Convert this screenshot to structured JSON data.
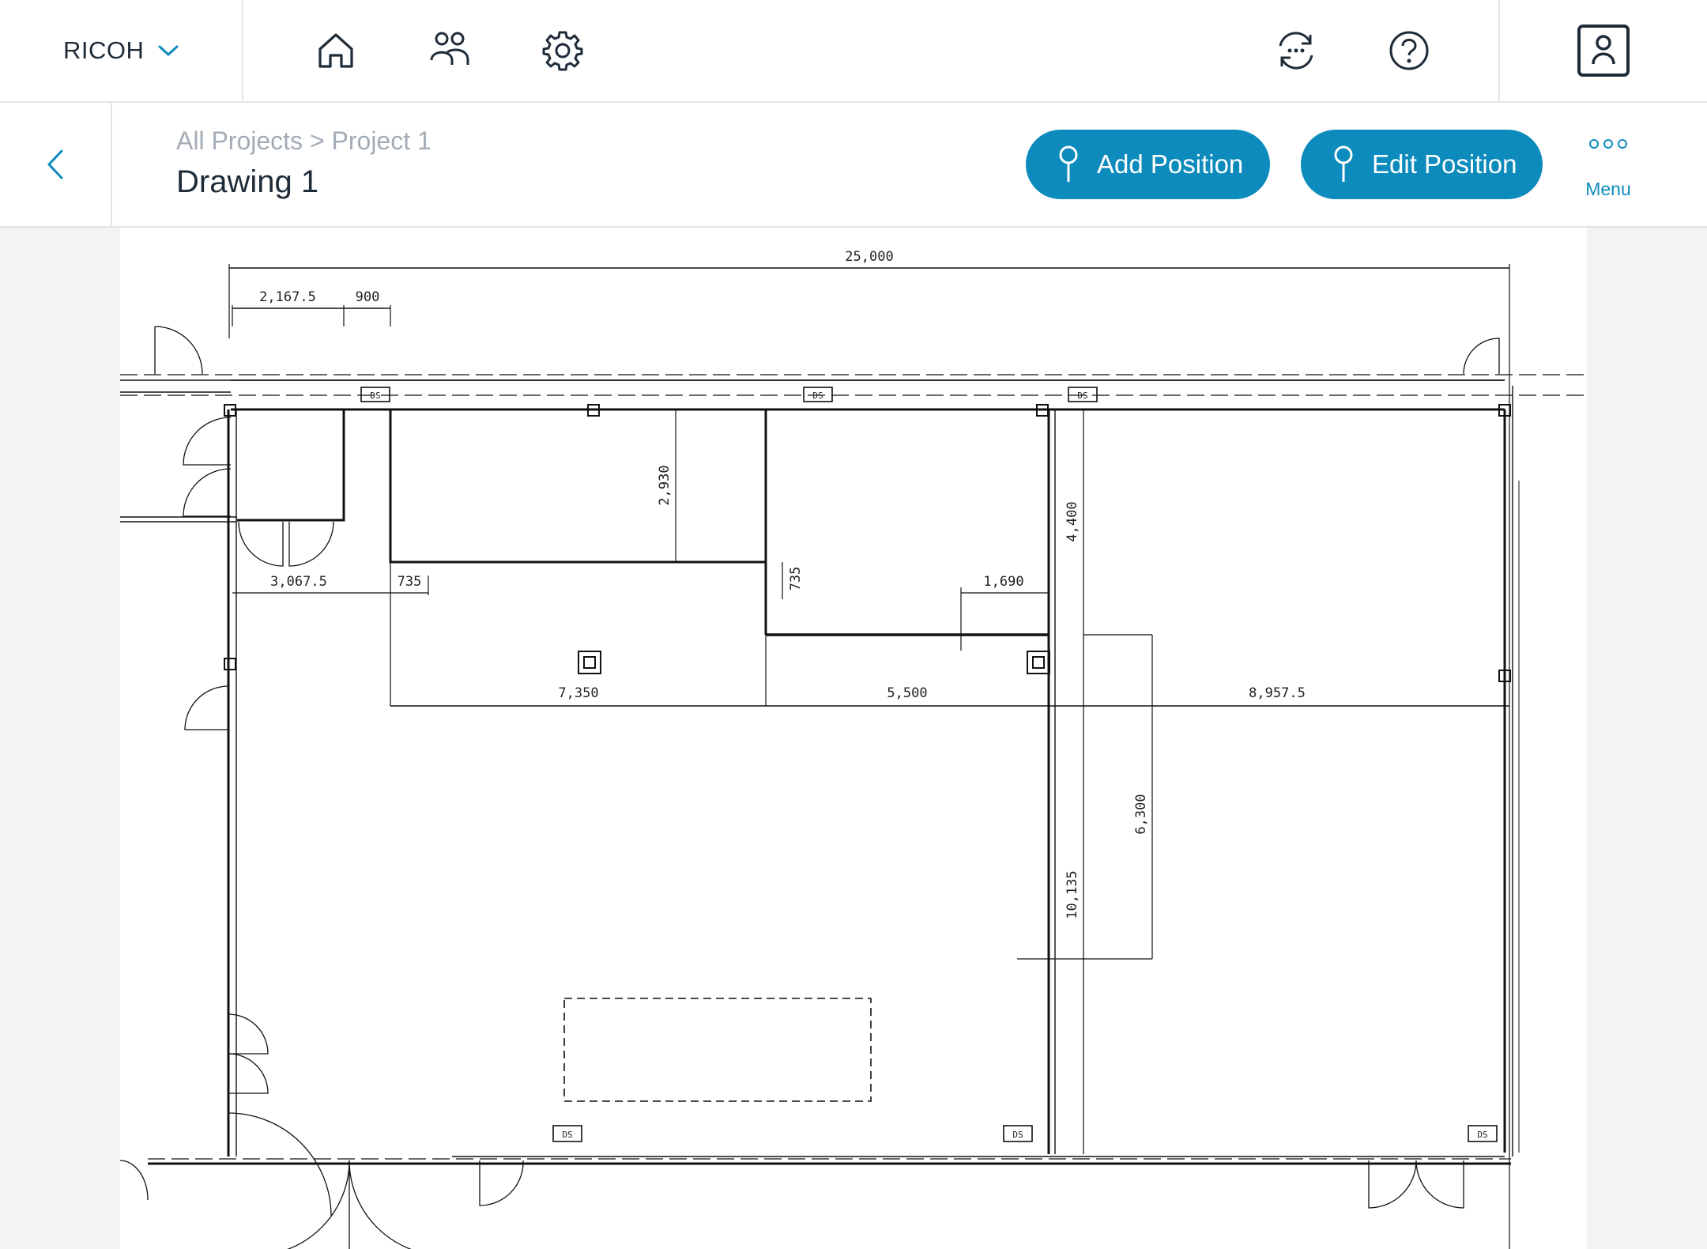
{
  "topbar": {
    "brand": "RICOH",
    "icons": [
      "home-icon",
      "users-icon",
      "gear-icon",
      "sync-icon",
      "help-icon",
      "profile-icon"
    ]
  },
  "subheader": {
    "breadcrumb": {
      "root": "All Projects",
      "separator": ">",
      "current": "Project 1"
    },
    "title": "Drawing 1",
    "add_position_label": "Add Position",
    "edit_position_label": "Edit Position",
    "menu_label": "Menu"
  },
  "drawing": {
    "dimensions": {
      "overall_width": "25,000",
      "d1": "2,167.5",
      "d2": "900",
      "d3": "2,930",
      "d4": "4,400",
      "d5": "3,067.5",
      "d6": "735",
      "d7": "735",
      "d8": "1,690",
      "d9": "7,350",
      "d10": "5,500",
      "d11": "8,957.5",
      "d12": "6,300",
      "d13": "10,135"
    },
    "fixture_label": "DS"
  },
  "colors": {
    "accent": "#0d8bbd",
    "text": "#1e2b38",
    "muted": "#a3acb6",
    "border": "#e2e5e8",
    "canvas_bg": "#f3f3f3"
  }
}
